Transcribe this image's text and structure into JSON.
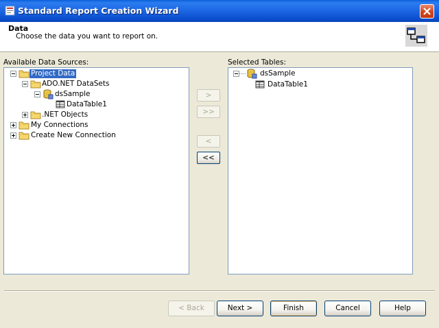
{
  "window": {
    "title": "Standard Report Creation Wizard"
  },
  "header": {
    "title": "Data",
    "subtitle": "Choose the data you want to report on."
  },
  "left_panel": {
    "label": "Available Data Sources:",
    "nodes": [
      {
        "label": "Project Data",
        "expander": "minus",
        "icon": "folder-icon"
      },
      {
        "label": "ADO.NET DataSets",
        "expander": "minus",
        "icon": "folder-icon"
      },
      {
        "label": "dsSample",
        "expander": "minus",
        "icon": "dataset-icon"
      },
      {
        "label": "DataTable1",
        "expander": "none",
        "icon": "table-icon"
      },
      {
        "label": ".NET Objects",
        "expander": "plus",
        "icon": "folder-icon"
      },
      {
        "label": "My Connections",
        "expander": "plus",
        "icon": "folder-icon"
      },
      {
        "label": "Create New Connection",
        "expander": "plus",
        "icon": "folder-icon"
      }
    ],
    "selected": "Project Data"
  },
  "move_buttons": {
    "add": ">",
    "add_all": ">>",
    "remove": "<",
    "remove_all": "<<"
  },
  "right_panel": {
    "label": "Selected Tables:",
    "nodes": [
      {
        "label": "dsSample",
        "expander": "minus",
        "icon": "dataset-icon"
      },
      {
        "label": "DataTable1",
        "expander": "none",
        "icon": "table-icon"
      }
    ]
  },
  "footer": {
    "back": "< Back",
    "next": "Next >",
    "finish": "Finish",
    "cancel": "Cancel",
    "help": "Help"
  },
  "colors": {
    "title_bar": "#0b57d6",
    "selection": "#316ac5",
    "dialog_bg": "#ece9d8",
    "close_button": "#d1461f"
  }
}
